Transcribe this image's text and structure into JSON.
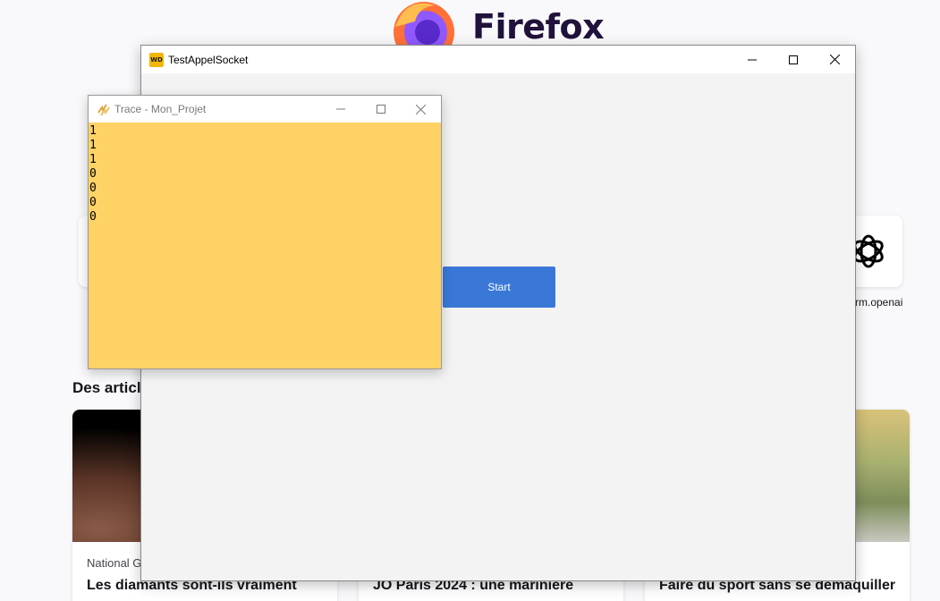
{
  "firefox": {
    "brand": "Firefox",
    "shortcut_label": "rm.openai",
    "section_title": "Des article",
    "cards": [
      {
        "source": "National G",
        "title": "Les diamants sont-ils vraiment"
      },
      {
        "source": "",
        "title": "JO Paris 2024 : une marinière"
      },
      {
        "source": "",
        "title": "Faire du sport sans se démaquiller"
      }
    ]
  },
  "main_window": {
    "title": "TestAppelSocket",
    "icon_text": "WD",
    "start_label": "Start"
  },
  "trace_window": {
    "title": "Trace - Mon_Projet",
    "lines": [
      "1",
      "1",
      "1",
      "0",
      "0",
      "0",
      "0"
    ]
  },
  "colors": {
    "trace_bg": "#ffd265",
    "start_button": "#3a78d8",
    "window_bg": "#f3f3f3"
  }
}
